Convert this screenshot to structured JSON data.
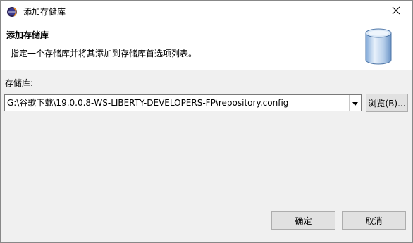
{
  "window": {
    "title": "添加存储库"
  },
  "banner": {
    "title": "添加存储库",
    "description": "指定一个存储库并将其添加到存储库首选项列表。",
    "image_icon": "database-cylinder-icon"
  },
  "form": {
    "repository_label": "存储库:",
    "repository_value": "G:\\谷歌下载\\19.0.0.8-WS-LIBERTY-DEVELOPERS-FP\\repository.config",
    "browse_label": "浏览(B)..."
  },
  "footer": {
    "ok_label": "确定",
    "cancel_label": "取消"
  },
  "icons": {
    "app": "eclipse-app-icon",
    "close": "close-icon",
    "dropdown": "chevron-down-icon"
  }
}
